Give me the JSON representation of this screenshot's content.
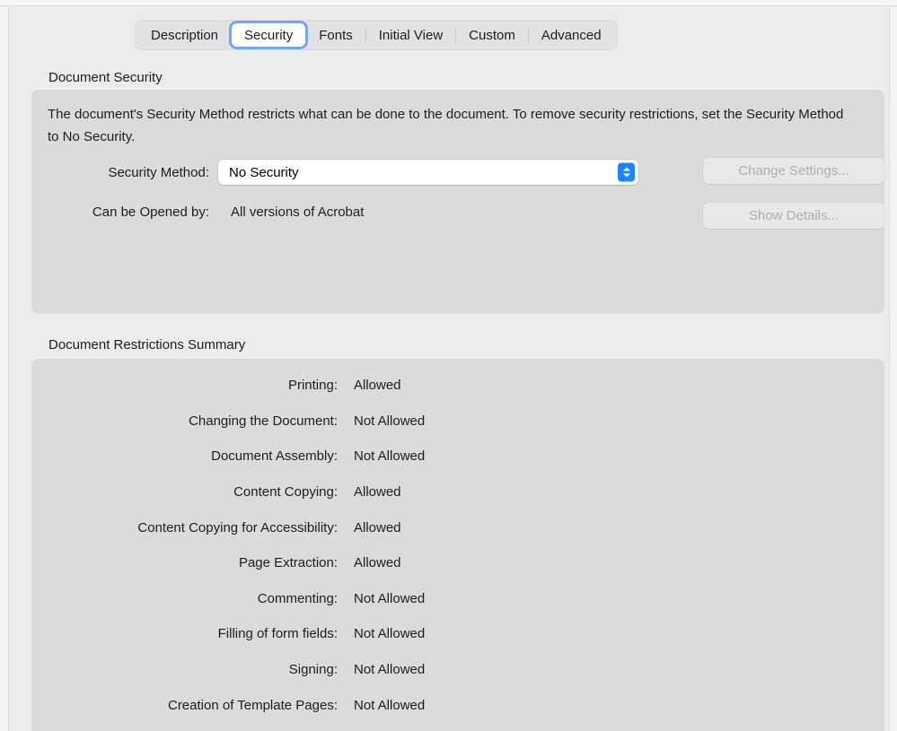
{
  "tabs": [
    {
      "label": "Description",
      "selected": false
    },
    {
      "label": "Security",
      "selected": true
    },
    {
      "label": "Fonts",
      "selected": false
    },
    {
      "label": "Initial View",
      "selected": false
    },
    {
      "label": "Custom",
      "selected": false
    },
    {
      "label": "Advanced",
      "selected": false
    }
  ],
  "document_security": {
    "section_title": "Document Security",
    "description": "The document's Security Method restricts what can be done to the document. To remove security restrictions, set the Security Method to No Security.",
    "security_method_label": "Security Method:",
    "security_method_value": "No Security",
    "security_method_options": [
      "No Security"
    ],
    "can_be_opened_by_label": "Can be Opened by:",
    "can_be_opened_by_value": "All versions of Acrobat",
    "change_settings_button": "Change Settings...",
    "show_details_button": "Show Details..."
  },
  "document_restrictions": {
    "section_title": "Document Restrictions Summary",
    "rows": [
      {
        "label": "Printing:",
        "value": "Allowed"
      },
      {
        "label": "Changing the Document:",
        "value": "Not Allowed"
      },
      {
        "label": "Document Assembly:",
        "value": "Not Allowed"
      },
      {
        "label": "Content Copying:",
        "value": "Allowed"
      },
      {
        "label": "Content Copying for Accessibility:",
        "value": "Allowed"
      },
      {
        "label": "Page Extraction:",
        "value": "Allowed"
      },
      {
        "label": "Commenting:",
        "value": "Not Allowed"
      },
      {
        "label": "Filling of form fields:",
        "value": "Not Allowed"
      },
      {
        "label": "Signing:",
        "value": "Not Allowed"
      },
      {
        "label": "Creation of Template Pages:",
        "value": "Not Allowed"
      }
    ]
  },
  "colors": {
    "window_background": "#ececec",
    "panel_background": "#dcdbdc",
    "tabbar_background": "#e2e1e3",
    "selected_tab_background": "#ffffff",
    "focus_ring": "#6ea8f4",
    "popup_accent": "#1a84ff",
    "text": "#1c1c1e",
    "disabled_text": "#aeadaf"
  }
}
